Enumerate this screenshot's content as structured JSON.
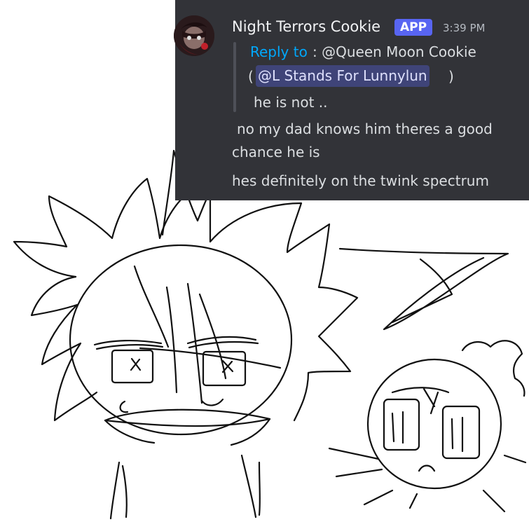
{
  "message": {
    "author": "Night Terrors Cookie",
    "badge": "APP",
    "timestamp": "3:39 PM",
    "reply_prefix": "Reply to",
    "reply_target": ": @Queen Moon Cookie",
    "mention": "@L Stands For Lunnylun",
    "paren_open": "(",
    "paren_close": ")",
    "quoted_text": "he is not ..",
    "lines": [
      "no my dad knows him theres a good",
      "chance he is",
      "hes definitely on the twink spectrum"
    ]
  },
  "colors": {
    "panel_bg": "#323338",
    "author": "#f2f3f5",
    "badge_bg": "#5865f2",
    "reply_link": "#00a8fc",
    "body_text": "#dbdee1",
    "timestamp": "#b5bac1"
  },
  "icons": [
    "avatar-image"
  ]
}
